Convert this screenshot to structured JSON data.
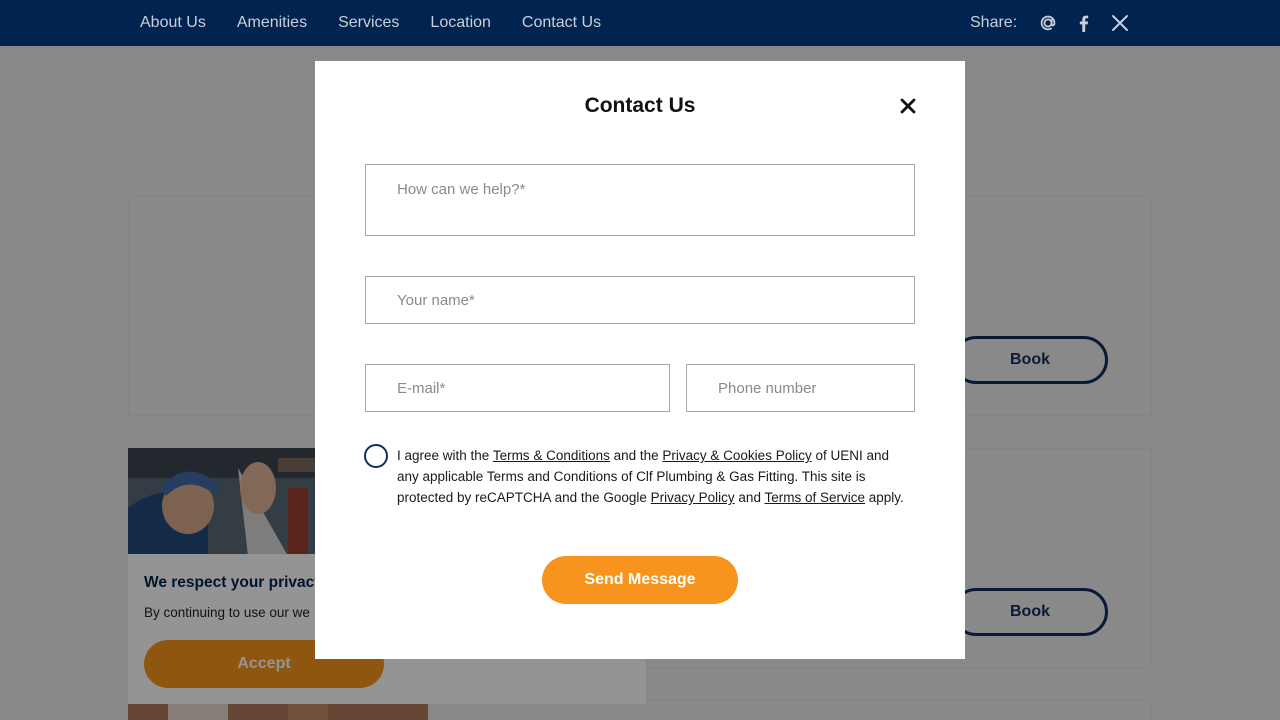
{
  "nav": {
    "links": [
      {
        "label": "About Us"
      },
      {
        "label": "Amenities"
      },
      {
        "label": "Services"
      },
      {
        "label": "Location"
      },
      {
        "label": "Contact Us"
      }
    ],
    "share_label": "Share:",
    "share_icons": [
      "email-at-icon",
      "facebook-icon",
      "x-icon"
    ]
  },
  "page": {
    "book_label": "Book"
  },
  "cookie": {
    "title": "We respect your privacy",
    "text": "By continuing to use our we",
    "accept_label": "Accept"
  },
  "modal": {
    "title": "Contact Us",
    "help_placeholder": "How can we help?*",
    "name_placeholder": "Your name*",
    "email_placeholder": "E-mail*",
    "phone_placeholder": "Phone number",
    "consent": {
      "t1": "I agree with the ",
      "link_terms": "Terms & Conditions",
      "t2": " and the ",
      "link_privacy_cookies": "Privacy & Cookies Policy",
      "t3": " of UENI and any applicable Terms and Conditions of Clf Plumbing & Gas Fitting. This site is protected by reCAPTCHA and the Google ",
      "link_privacy": "Privacy Policy",
      "t4": " and ",
      "link_tos": "Terms of Service",
      "t5": " apply."
    },
    "send_label": "Send Message"
  },
  "colors": {
    "navy": "#00234f",
    "accent_orange": "#f7941d",
    "outline_navy": "#0f2e5f"
  }
}
